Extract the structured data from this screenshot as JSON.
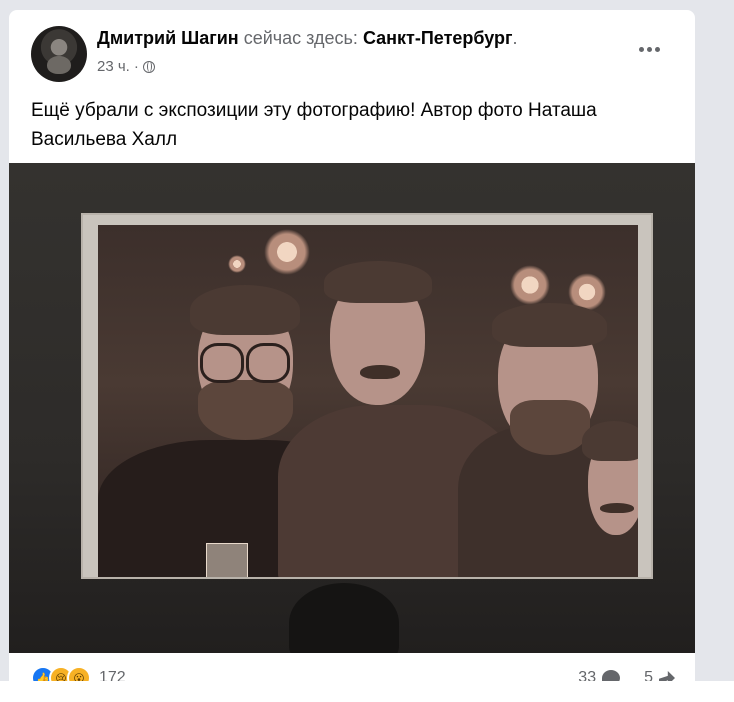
{
  "post": {
    "author": "Дмитрий Шагин",
    "status_prefix": "сейчас здесь:",
    "place": "Санкт-Петербург",
    "status_suffix": ".",
    "time": "23 ч.",
    "separator": "·",
    "privacy_icon": "globe-icon",
    "text": "Ещё убрали с экспозиции эту фотографию! Автор фото Наташа Васильева Халл"
  },
  "reactions": {
    "icons": [
      "like-icon",
      "sad-icon",
      "wow-icon"
    ],
    "count": "172",
    "comments": "33",
    "shares": "5"
  },
  "colors": {
    "background": "#e4e6eb",
    "card": "#ffffff",
    "secondary_text": "#65676b",
    "primary_text": "#050505",
    "like_blue": "#1877f2"
  }
}
